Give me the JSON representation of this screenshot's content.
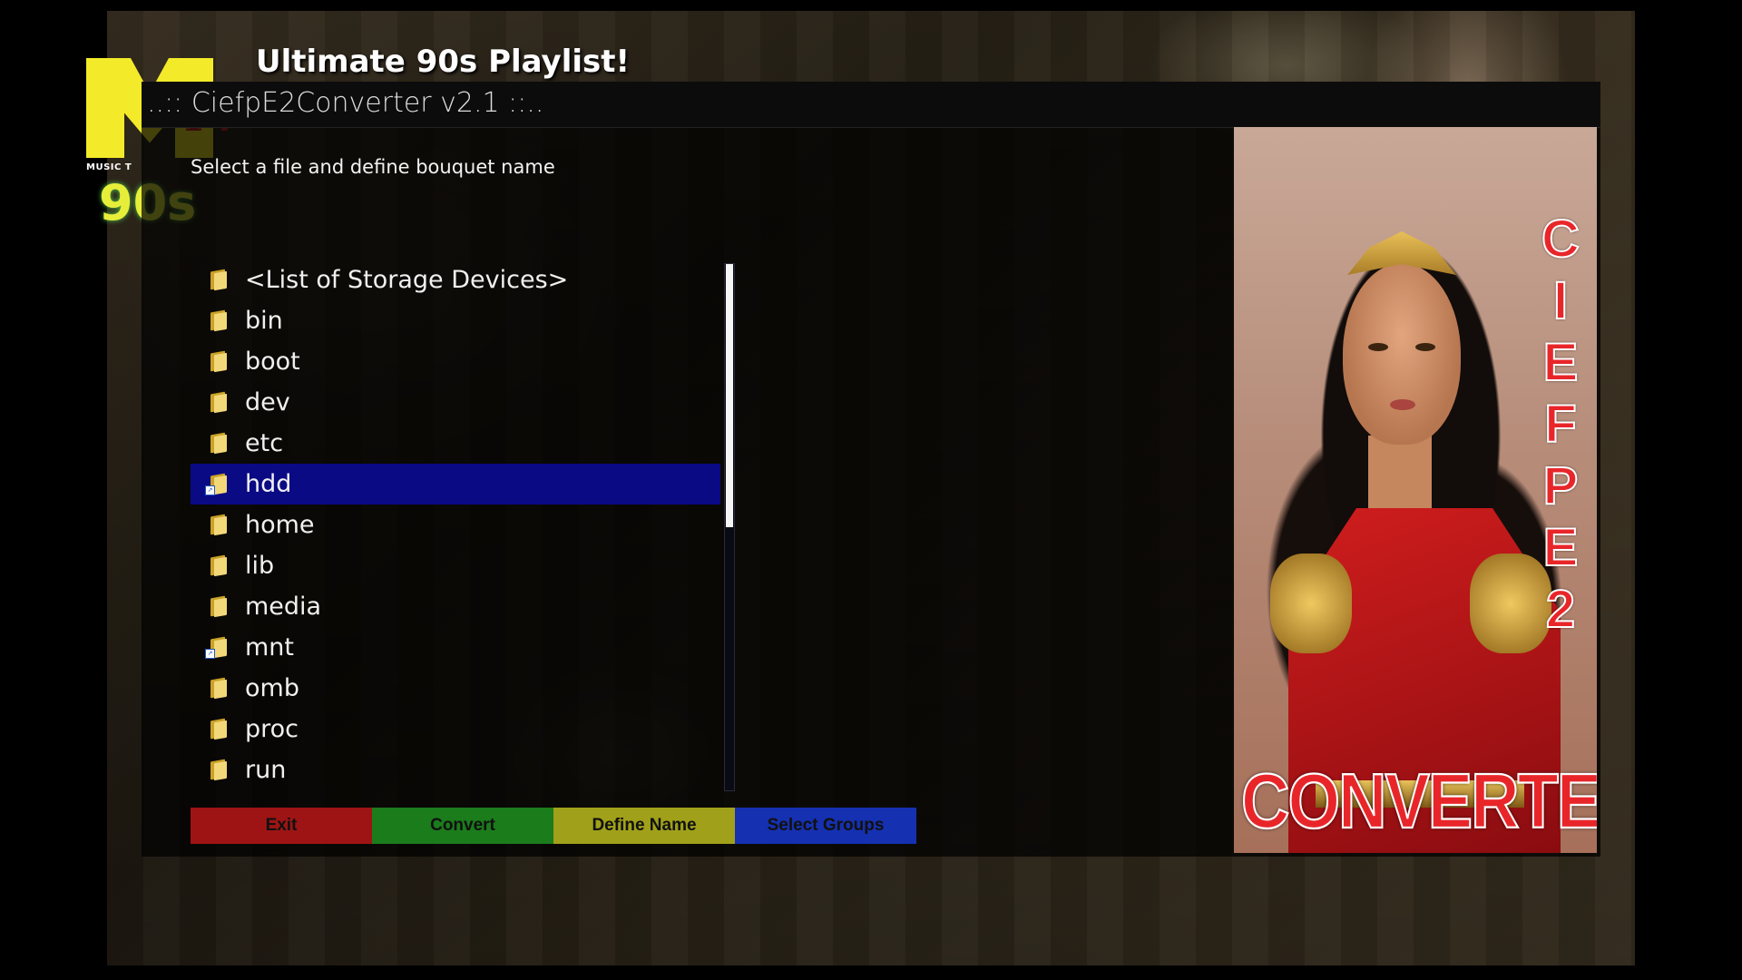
{
  "background": {
    "promo_title": "Ultimate 90s Playlist!",
    "logo": {
      "letter": "M",
      "tv": "TV",
      "subtitle": "MUSIC T",
      "decade": "90s"
    }
  },
  "window": {
    "title": "..:: CiefpE2Converter v2.1 ::..",
    "subtitle": "Select a file and define bouquet name"
  },
  "file_list": {
    "items": [
      {
        "label": "<List of Storage Devices>",
        "icon": "folder-icon",
        "link": false
      },
      {
        "label": "bin",
        "icon": "folder-icon",
        "link": false
      },
      {
        "label": "boot",
        "icon": "folder-icon",
        "link": false
      },
      {
        "label": "dev",
        "icon": "folder-icon",
        "link": false
      },
      {
        "label": "etc",
        "icon": "folder-icon",
        "link": false
      },
      {
        "label": "hdd",
        "icon": "folder-link-icon",
        "link": true
      },
      {
        "label": "home",
        "icon": "folder-icon",
        "link": false
      },
      {
        "label": "lib",
        "icon": "folder-icon",
        "link": false
      },
      {
        "label": "media",
        "icon": "folder-icon",
        "link": false
      },
      {
        "label": "mnt",
        "icon": "folder-link-icon",
        "link": true
      },
      {
        "label": "omb",
        "icon": "folder-icon",
        "link": false
      },
      {
        "label": "proc",
        "icon": "folder-icon",
        "link": false
      },
      {
        "label": "run",
        "icon": "folder-icon",
        "link": false
      }
    ],
    "selected": "hdd",
    "selected_color": "#0a0a85",
    "scroll_fraction_visible": 0.5
  },
  "buttons": {
    "red": {
      "label": "Exit",
      "color": "#9e1414"
    },
    "green": {
      "label": "Convert",
      "color": "#1b7c1b"
    },
    "yellow": {
      "label": "Define Name",
      "color": "#a0a01a"
    },
    "blue": {
      "label": "Select Groups",
      "color": "#1530b0"
    }
  },
  "poster": {
    "vertical_letters": [
      "C",
      "I",
      "E",
      "F",
      "P",
      "E",
      "2"
    ],
    "bottom_text": "CONVERTER"
  }
}
